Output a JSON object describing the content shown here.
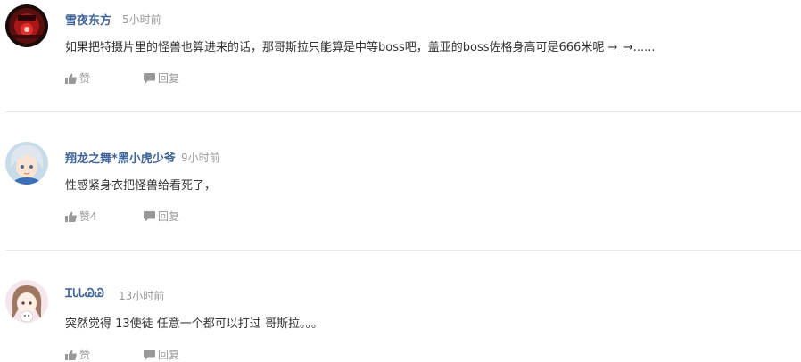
{
  "comments": [
    {
      "username": "雪夜东方",
      "time": "5小时前",
      "text": "如果把特摄片里的怪兽也算进来的话，那哥斯拉只能算是中等boss吧，盖亚的boss佐格身高可是666米呢 →_→......",
      "like_label": "赞",
      "reply_label": "回复",
      "avatar_icon": "red-robot-avatar"
    },
    {
      "username": "翔龙之舞*黑小虎少爷",
      "time": "9小时前",
      "text": "性感紧身衣把怪兽给看死了，",
      "like_label": "赞4",
      "reply_label": "回复",
      "avatar_icon": "anime-boy-avatar"
    },
    {
      "username": "ᏆᏓᏓᏊᏊ",
      "time": "13小时前",
      "text": "突然觉得 13使徒 任意一个都可以打过 哥斯拉。。。",
      "like_label": "赞",
      "reply_label": "回复",
      "avatar_icon": "anime-girl-avatar"
    }
  ],
  "colors": {
    "username": "#406599",
    "meta": "#999999",
    "text": "#333333",
    "divider": "#e8e8e8"
  }
}
